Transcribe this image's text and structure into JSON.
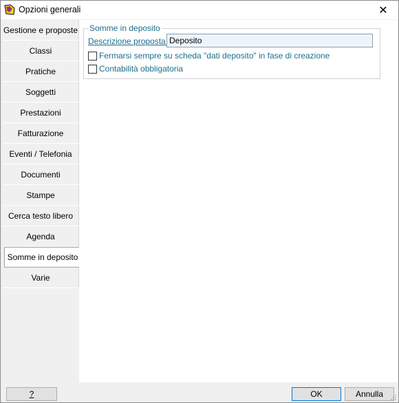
{
  "window": {
    "title": "Opzioni generali",
    "close_glyph": "✕"
  },
  "sidebar": {
    "items": [
      {
        "label": "Gestione e proposte"
      },
      {
        "label": "Classi"
      },
      {
        "label": "Pratiche"
      },
      {
        "label": "Soggetti"
      },
      {
        "label": "Prestazioni"
      },
      {
        "label": "Fatturazione"
      },
      {
        "label": "Eventi / Telefonia"
      },
      {
        "label": "Documenti"
      },
      {
        "label": "Stampe"
      },
      {
        "label": "Cerca testo libero"
      },
      {
        "label": "Agenda"
      },
      {
        "label": "Somme in deposito",
        "active": true
      },
      {
        "label": "Varie"
      }
    ]
  },
  "main": {
    "group_title": "Somme in deposito",
    "description_label": "Descrizione proposta:",
    "description_value": "Deposito",
    "checkbox_1_label": "Fermarsi sempre su scheda \"dati deposito\" in fase di creazione",
    "checkbox_1_checked": false,
    "checkbox_2_label": "Contabilità obbligatoria",
    "checkbox_2_checked": false
  },
  "footer": {
    "help_label": "?",
    "ok_label": "OK",
    "cancel_label": "Annulla"
  },
  "colors": {
    "accent_text": "#1a6e8a",
    "default_button_border": "#0078d7"
  }
}
